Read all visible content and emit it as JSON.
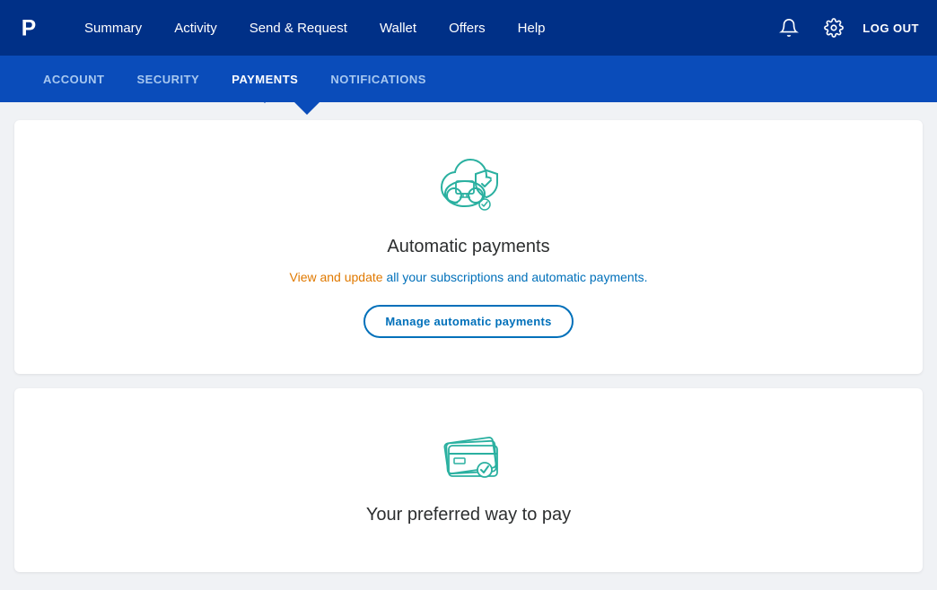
{
  "topNav": {
    "logoAlt": "PayPal",
    "links": [
      {
        "label": "Summary",
        "id": "summary"
      },
      {
        "label": "Activity",
        "id": "activity"
      },
      {
        "label": "Send & Request",
        "id": "send-request"
      },
      {
        "label": "Wallet",
        "id": "wallet"
      },
      {
        "label": "Offers",
        "id": "offers"
      },
      {
        "label": "Help",
        "id": "help"
      }
    ],
    "logoutLabel": "LOG OUT"
  },
  "subNav": {
    "links": [
      {
        "label": "ACCOUNT",
        "id": "account",
        "active": false
      },
      {
        "label": "SECURITY",
        "id": "security",
        "active": false
      },
      {
        "label": "PAYMENTS",
        "id": "payments",
        "active": true
      },
      {
        "label": "NOTIFICATIONS",
        "id": "notifications",
        "active": false
      }
    ]
  },
  "cards": [
    {
      "id": "automatic-payments",
      "title": "Automatic payments",
      "description_parts": [
        {
          "text": "View and update ",
          "style": "orange"
        },
        {
          "text": "all your subscriptions and automatic payments.",
          "style": "blue"
        }
      ],
      "description_full": "View and update all your subscriptions and automatic payments.",
      "buttonLabel": "Manage automatic payments"
    },
    {
      "id": "preferred-pay",
      "title": "Your preferred way to pay",
      "description_full": "",
      "buttonLabel": ""
    }
  ]
}
